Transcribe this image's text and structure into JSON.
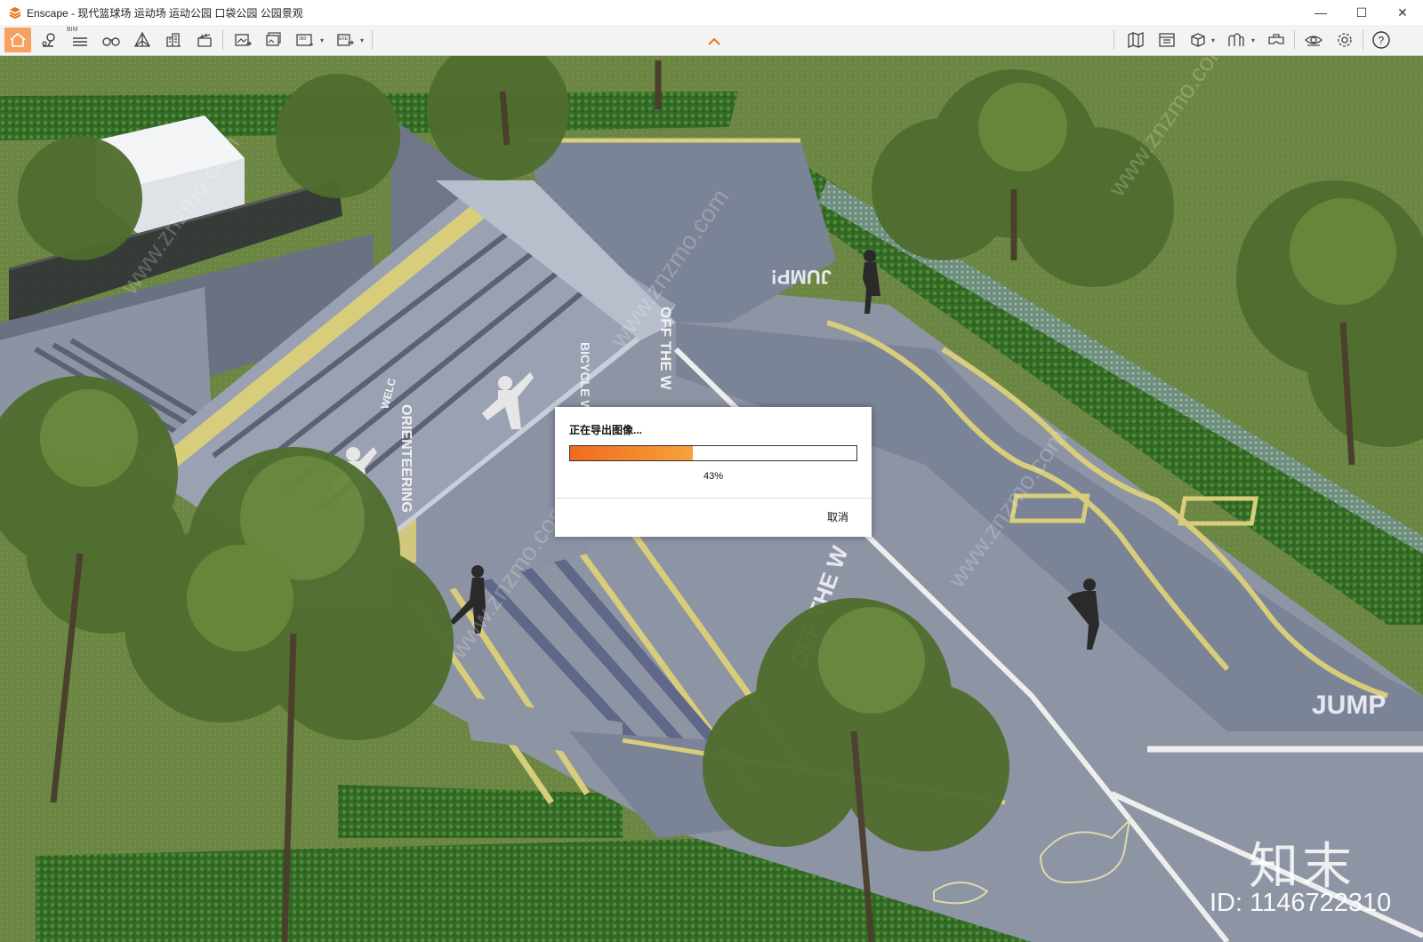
{
  "window": {
    "app_name": "Enscape",
    "title": "Enscape - 现代篮球场 运动场 运动公园 口袋公园 公园景观",
    "controls": {
      "minimize": "—",
      "maximize": "☐",
      "close": "✕"
    }
  },
  "toolbar": {
    "bim_label": "BIM",
    "left_icons": [
      "home-icon",
      "map-pin-icon",
      "bim-list-icon",
      "binoculars-icon",
      "cube-perspective-icon",
      "buildings-icon",
      "clapper-icon",
      "export-image-icon",
      "batch-export-icon",
      "panorama-360-icon",
      "export-exe-icon"
    ],
    "right_icons": [
      "map-icon",
      "asset-library-icon",
      "box-view-icon",
      "material-icon",
      "vr-headset-icon",
      "eye-icon",
      "settings-icon",
      "help-icon"
    ]
  },
  "scene": {
    "signage": {
      "jump_top": "JUMP!",
      "jump_right": "JUMP",
      "orienteering": "ORIENTEERING",
      "bicycle": "BICYCLE W",
      "off_the_wall": "OFF THE W",
      "off_the_wall_ground": "OFF THE W",
      "welcome": "WELC"
    },
    "colors": {
      "grass": "#6f8a45",
      "hedge": "#3f7a2e",
      "ramp": "#7b8497",
      "yellow_stripe": "#d8cd7b"
    }
  },
  "dialog": {
    "title": "正在导出图像...",
    "progress": 0.43,
    "progress_label": "43%",
    "cancel_label": "取消"
  },
  "watermark": {
    "logo_text": "知末",
    "id_text": "ID: 1146722310",
    "diagonal_text": "www.znzmo.com"
  }
}
